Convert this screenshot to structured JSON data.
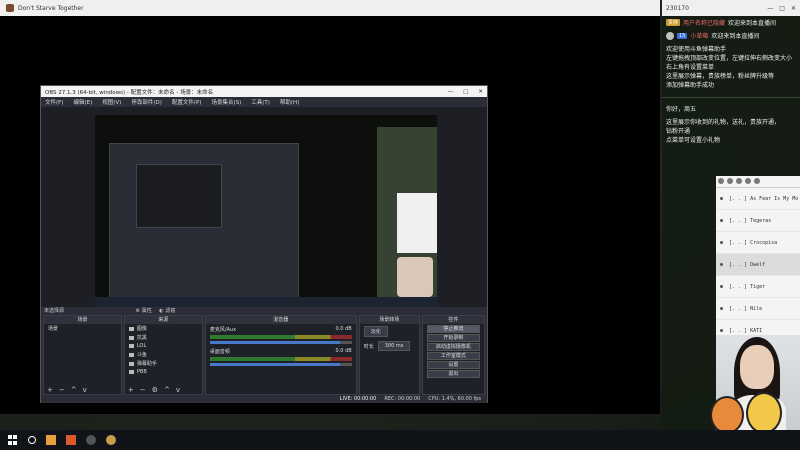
{
  "game_window": {
    "title": "Don't Starve Together"
  },
  "chat": {
    "viewer_count": "230170",
    "rows": [
      {
        "badge": "贵族",
        "name": "用户名称已隐藏",
        "text": "欢迎来到本直播间"
      },
      {
        "badge": "15",
        "name": "小草莓",
        "text": "欢迎来到本直播间"
      }
    ],
    "help_lines": [
      "欢迎使用斗鱼弹幕助手",
      "左键拖拽顶部改变位置，左键拉伸右侧改变大小",
      "右上角有设置菜单",
      "这里展示弹幕，贵族榜单，粉丝牌升级等",
      "添加弹幕助手成功"
    ],
    "footer_lines": [
      "这里展示你收到的礼物，送礼，贵族开通，",
      "钻粉开通",
      "点菜单可设置小礼物"
    ],
    "toast": "你好，周五"
  },
  "songlist": {
    "items": [
      {
        "text": "[. . ]   As Fear Is My Mo"
      },
      {
        "text": "[. . ]   Tegeras"
      },
      {
        "text": "[. . ]   Crocopisa"
      },
      {
        "text": "[. . ]   Dwelf",
        "selected": true
      },
      {
        "text": "[. . ]   Tiger"
      },
      {
        "text": "[. . ]   Nile"
      },
      {
        "text": "[. . ]   KATI"
      }
    ]
  },
  "obs": {
    "title": "OBS 27.1.3 (64-bit, windows) - 配置文件：未命名 - 场景：未命名",
    "menu": [
      "文件(F)",
      "编辑(E)",
      "视图(V)",
      "停靠部件(D)",
      "配置文件(P)",
      "场景集合(S)",
      "工具(T)",
      "帮助(H)"
    ],
    "status_source": "未选择源",
    "toolbar": {
      "props": "属性",
      "filters": "滤镜"
    },
    "docks": {
      "scenes": {
        "title": "场景",
        "items": [
          "场景"
        ]
      },
      "sources": {
        "title": "来源",
        "items": [
          "图像",
          "抗黑",
          "LOL",
          "斗鱼",
          "弹幕助手",
          "PBB"
        ]
      },
      "mixer": {
        "title": "混音器",
        "channels": [
          {
            "name": "麦克风/Aux",
            "db": "0.0 dB"
          },
          {
            "name": "桌面音频",
            "db": "0.0 dB"
          }
        ]
      },
      "transitions": {
        "title": "场景转场",
        "type": "淡化",
        "duration_label": "时长",
        "duration": "300 ms"
      },
      "controls": {
        "title": "控件",
        "buttons": [
          "停止推流",
          "开始录制",
          "启动虚拟摄像机",
          "工作室模式",
          "设置",
          "退出"
        ]
      }
    },
    "statusbar": {
      "live": "LIVE: 00:00:00",
      "rec": "REC: 00:00:00",
      "cpu": "CPU: 1.4%, 60.00 fps"
    }
  }
}
